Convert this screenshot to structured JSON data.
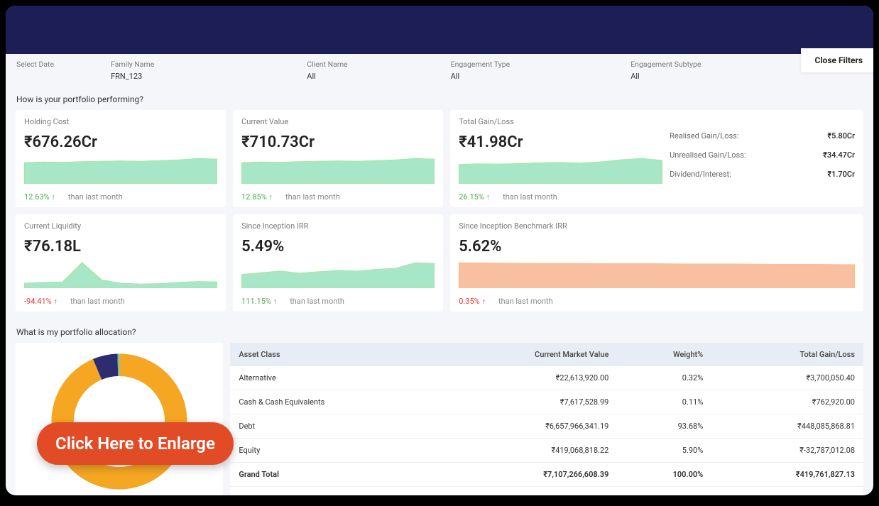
{
  "filters": {
    "select_date_label": "Select Date",
    "family_name_label": "Family Name",
    "family_name_value": "FRN_123",
    "client_name_label": "Client Name",
    "client_name_value": "All",
    "engagement_type_label": "Engagement Type",
    "engagement_type_value": "All",
    "engagement_subtype_label": "Engagement Subtype",
    "engagement_subtype_value": "All",
    "close_filters": "Close Filters"
  },
  "section1_title": "How is your portfolio performing?",
  "kpi": {
    "holding_cost": {
      "label": "Holding Cost",
      "value": "₹676.26Cr",
      "delta": "12.63%",
      "arrow": "↑",
      "delta_class": "pos",
      "than": "than last month"
    },
    "current_value": {
      "label": "Current Value",
      "value": "₹710.73Cr",
      "delta": "12.85%",
      "arrow": "↑",
      "delta_class": "pos",
      "than": "than last month"
    },
    "total_gain": {
      "label": "Total Gain/Loss",
      "value": "₹41.98Cr",
      "delta": "26.15%",
      "arrow": "↑",
      "delta_class": "pos",
      "than": "than last month"
    },
    "side": {
      "realised_label": "Realised Gain/Loss:",
      "realised_value": "₹5.80Cr",
      "unrealised_label": "Unrealised  Gain/Loss:",
      "unrealised_value": "₹34.47Cr",
      "dividend_label": "Dividend/Interest:",
      "dividend_value": "₹1.70Cr"
    },
    "liquidity": {
      "label": "Current Liquidity",
      "value": "₹76.18L",
      "delta": "-94.41%",
      "arrow": "↑",
      "delta_class": "neg",
      "than": "than last month"
    },
    "irr": {
      "label": "Since Inception IRR",
      "value": "5.49%",
      "delta": "111.15%",
      "arrow": "↑",
      "delta_class": "pos",
      "than": "than last month"
    },
    "bench_irr": {
      "label": "Since Inception Benchmark IRR",
      "value": "5.62%",
      "delta": "0.35%",
      "arrow": "↑",
      "delta_class": "neg",
      "than": "than last month"
    }
  },
  "section2_title": "What is my portfolio allocation?",
  "alloc_table": {
    "headers": {
      "asset": "Asset Class",
      "cmv": "Current Market Value",
      "weight": "Weight%",
      "gain": "Total Gain/Loss"
    },
    "rows": [
      {
        "asset": "Alternative",
        "cmv": "₹22,613,920.00",
        "weight": "0.32%",
        "gain": "₹3,700,050.40"
      },
      {
        "asset": "Cash & Cash Equivalents",
        "cmv": "₹7,617,528.99",
        "weight": "0.11%",
        "gain": "₹762,920.00"
      },
      {
        "asset": "Debt",
        "cmv": "₹6,657,966,341.19",
        "weight": "93.68%",
        "gain": "₹448,085,868.81"
      },
      {
        "asset": "Equity",
        "cmv": "₹419,068,818.22",
        "weight": "5.90%",
        "gain": "₹-32,787,012.08"
      },
      {
        "asset": "Grand Total",
        "cmv": "₹7,107,266,608.39",
        "weight": "100.00%",
        "gain": "₹419,761,827.13"
      }
    ]
  },
  "chart_data": {
    "donut": {
      "type": "pie",
      "series": [
        {
          "name": "Debt",
          "value": 93.68,
          "color": "#f5a623"
        },
        {
          "name": "Equity",
          "value": 5.9,
          "color": "#2c2c6e"
        },
        {
          "name": "Alternative",
          "value": 0.32,
          "color": "#1ec8c8"
        },
        {
          "name": "Cash & Cash Equivalents",
          "value": 0.11,
          "color": "#cccccc"
        }
      ]
    },
    "sparklines": {
      "holding_cost": {
        "type": "area",
        "color": "#a7e6c6",
        "values": [
          60,
          62,
          61,
          63,
          64,
          65,
          64,
          66,
          68,
          72,
          70
        ]
      },
      "current_value": {
        "type": "area",
        "color": "#a7e6c6",
        "values": [
          60,
          62,
          61,
          63,
          64,
          65,
          64,
          66,
          68,
          72,
          70
        ]
      },
      "total_gain": {
        "type": "area",
        "color": "#a7e6c6",
        "values": [
          58,
          60,
          59,
          61,
          63,
          64,
          62,
          66,
          72,
          76,
          70
        ]
      },
      "liquidity": {
        "type": "area",
        "color": "#a7e6c6",
        "values": [
          12,
          14,
          15,
          60,
          20,
          12,
          10,
          11,
          14,
          16,
          15
        ]
      },
      "irr": {
        "type": "area",
        "color": "#a7e6c6",
        "values": [
          40,
          45,
          50,
          44,
          48,
          52,
          50,
          55,
          58,
          74,
          72
        ]
      },
      "bench_irr": {
        "type": "area",
        "color": "#f8bfa0",
        "values": [
          80,
          79,
          78,
          78,
          77,
          77,
          76,
          76,
          75,
          75,
          74
        ]
      }
    }
  },
  "enlarge_label": "Click Here to Enlarge"
}
